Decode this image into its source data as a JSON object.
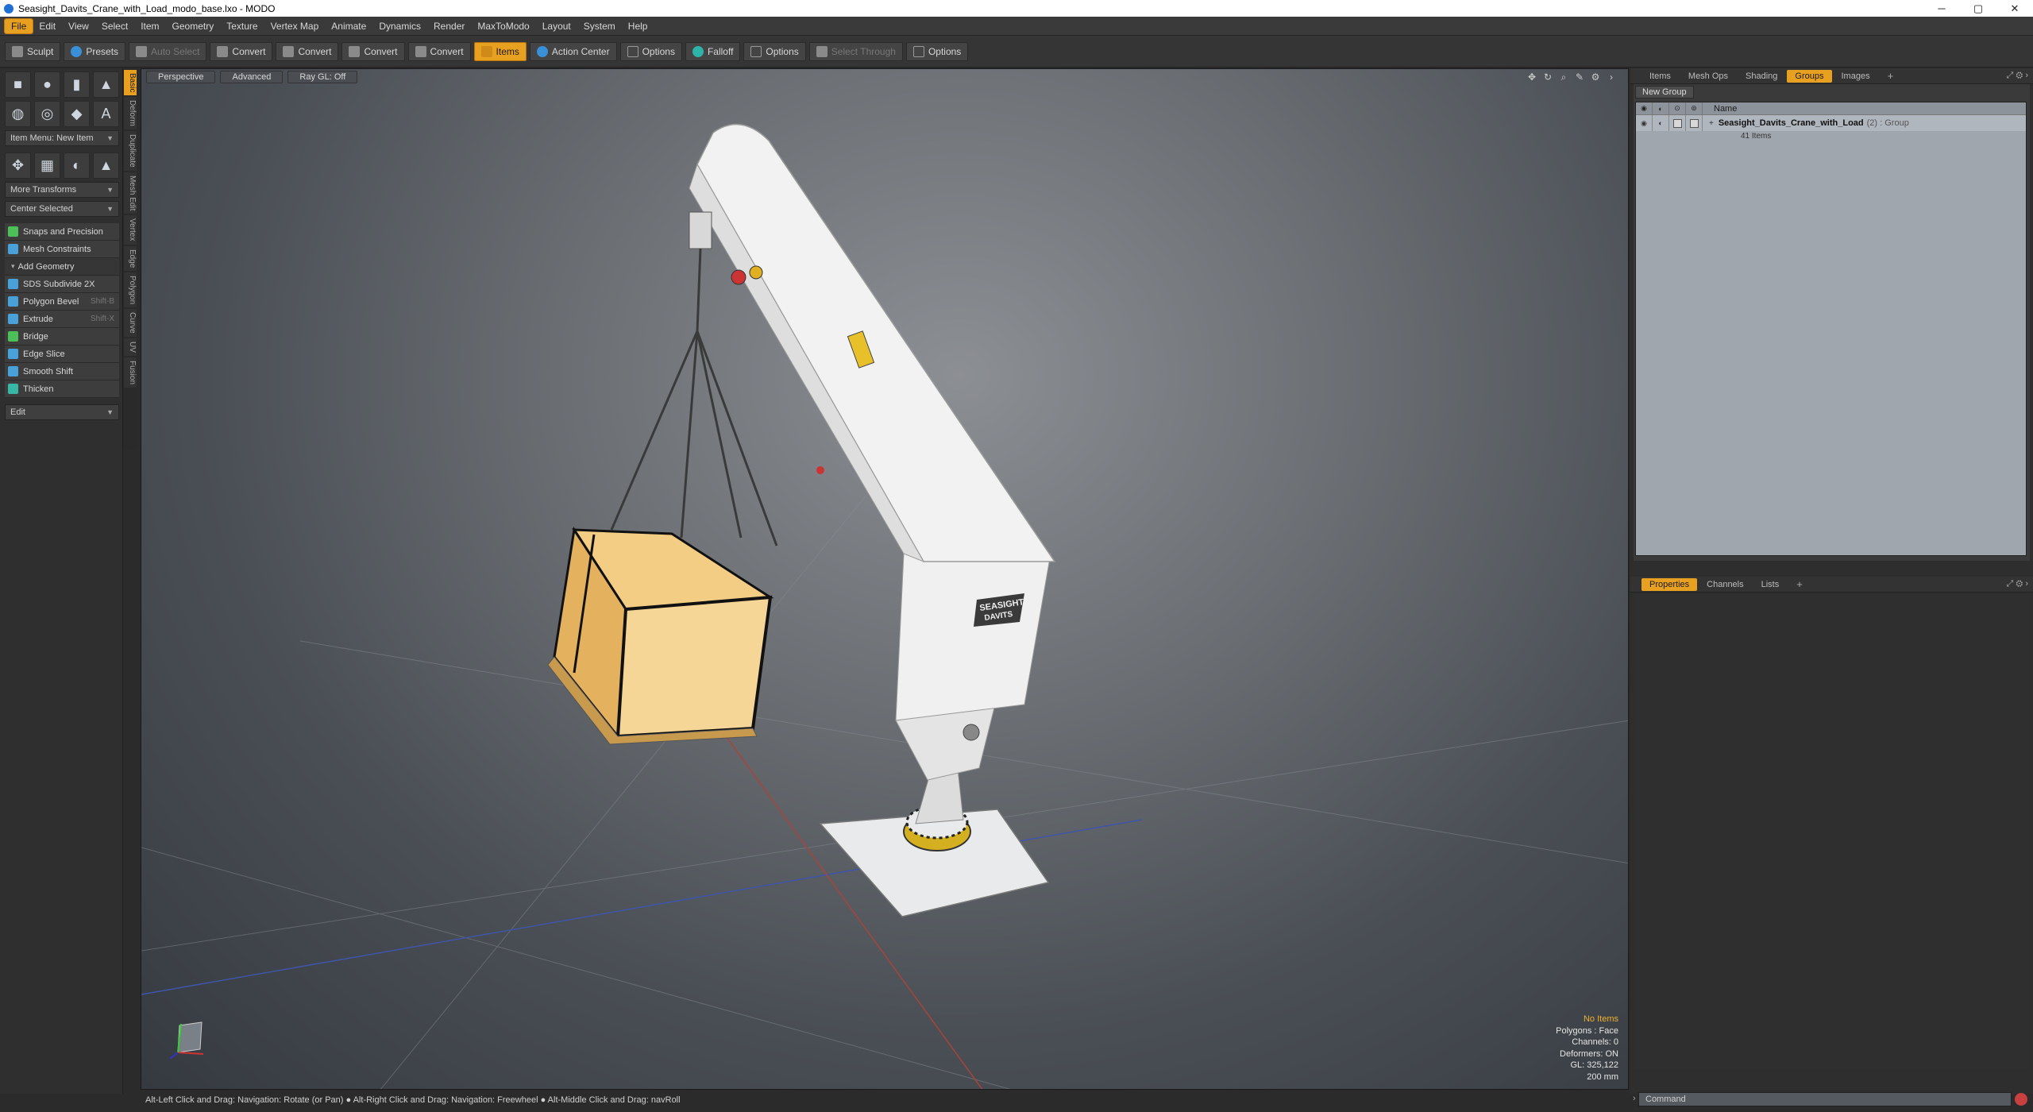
{
  "window": {
    "title": "Seasight_Davits_Crane_with_Load_modo_base.lxo - MODO",
    "min": "─",
    "max": "▢",
    "close": "✕"
  },
  "menu": [
    "File",
    "Edit",
    "View",
    "Select",
    "Item",
    "Geometry",
    "Texture",
    "Vertex Map",
    "Animate",
    "Dynamics",
    "Render",
    "MaxToModo",
    "Layout",
    "System",
    "Help"
  ],
  "toolbar": {
    "sculpt": "Sculpt",
    "presets": "Presets",
    "auto_select": "Auto Select",
    "convert1": "Convert",
    "convert2": "Convert",
    "convert3": "Convert",
    "convert4": "Convert",
    "items": "Items",
    "action_center": "Action Center",
    "options1": "Options",
    "falloff": "Falloff",
    "options2": "Options",
    "select_through": "Select Through",
    "options3": "Options"
  },
  "left": {
    "item_menu": "Item Menu: New Item",
    "more_transforms": "More Transforms",
    "center_selected": "Center Selected",
    "snaps": "Snaps and Precision",
    "mesh_constraints": "Mesh Constraints",
    "add_geometry": "Add Geometry",
    "tools": [
      {
        "label": "SDS Subdivide 2X",
        "shortcut": ""
      },
      {
        "label": "Polygon Bevel",
        "shortcut": "Shift-B"
      },
      {
        "label": "Extrude",
        "shortcut": "Shift-X"
      },
      {
        "label": "Bridge",
        "shortcut": ""
      },
      {
        "label": "Edge Slice",
        "shortcut": ""
      },
      {
        "label": "Smooth Shift",
        "shortcut": ""
      },
      {
        "label": "Thicken",
        "shortcut": ""
      }
    ],
    "edit": "Edit",
    "vtabs": [
      "Basic",
      "Deform",
      "Duplicate",
      "Mesh Edit",
      "Vertex",
      "Edge",
      "Polygon",
      "Curve",
      "UV",
      "Fusion"
    ]
  },
  "viewport": {
    "tabs": [
      "Perspective",
      "Advanced",
      "Ray GL: Off"
    ],
    "info": {
      "no_items": "No Items",
      "polygons": "Polygons : Face",
      "channels": "Channels: 0",
      "deformers": "Deformers: ON",
      "gl": "GL: 325,122",
      "size": "200 mm"
    },
    "crane_logo_line1": "SEASIGHT",
    "crane_logo_line2": "DAVITS"
  },
  "right": {
    "tabs": [
      "Items",
      "Mesh Ops",
      "Shading",
      "Groups",
      "Images"
    ],
    "new_group": "New Group",
    "name_header": "Name",
    "group_name": "Seasight_Davits_Crane_with_Load",
    "group_extra": "(2) : Group",
    "group_items": "41 Items",
    "bottom_tabs": [
      "Properties",
      "Channels",
      "Lists"
    ]
  },
  "command_placeholder": "Command",
  "status": "Alt-Left Click and Drag: Navigation: Rotate (or Pan) ● Alt-Right Click and Drag: Navigation: Freewheel ● Alt-Middle Click and Drag: navRoll",
  "colors": {
    "accent": "#e8a020",
    "viewport_center": "#8c8f94",
    "panel": "#2e2e2e"
  }
}
